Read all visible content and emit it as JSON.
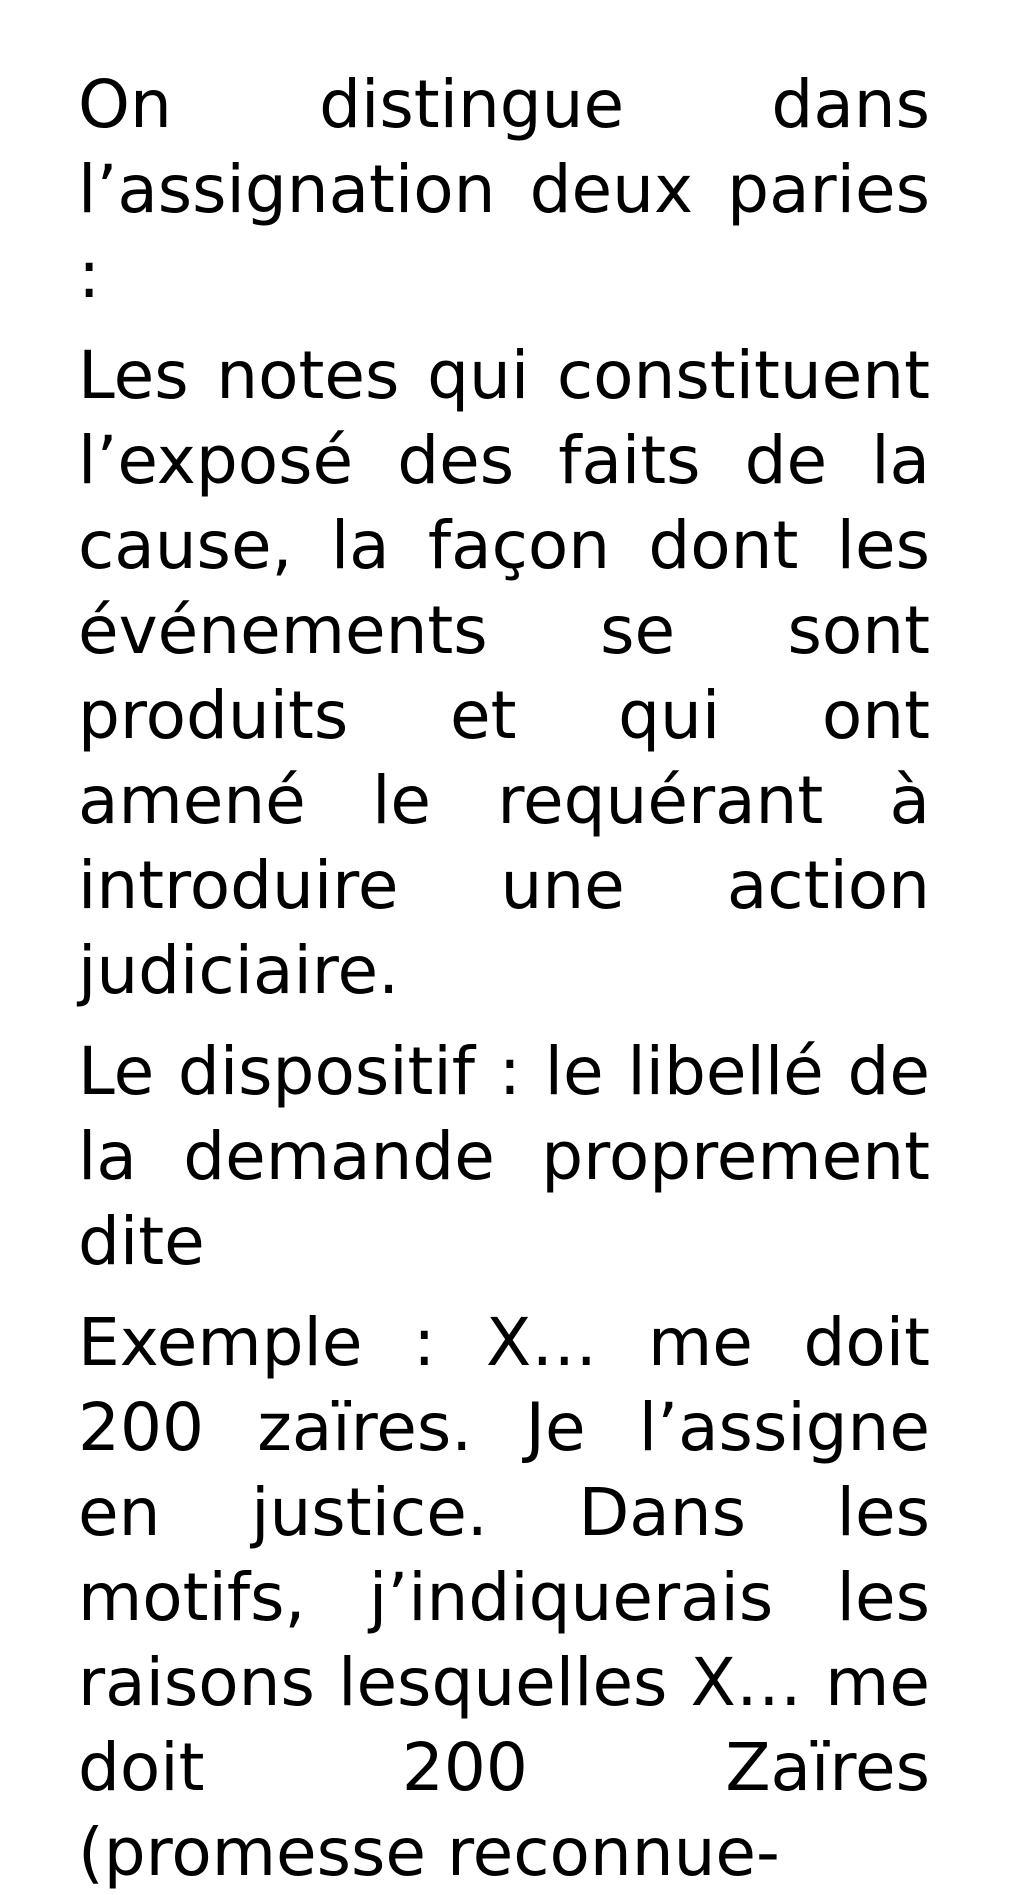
{
  "document": {
    "paragraphs": [
      "On distingue dans l’assignation deux paries :",
      "Les notes qui constituent l’exposé des faits de la cause, la façon dont les événements se sont produits et qui ont amené le requérant à introduire une action judiciaire.",
      "Le dispositif : le libellé de la demande proprement dite",
      "Exemple : X… me doit 200 zaïres. Je l’assigne en justice. Dans les motifs, j’indiquerais les raisons lesquelles X… me doit 200 Zaïres (promesse reconnue-"
    ]
  },
  "colors": {
    "background": "#ffffff",
    "text": "#000000"
  }
}
